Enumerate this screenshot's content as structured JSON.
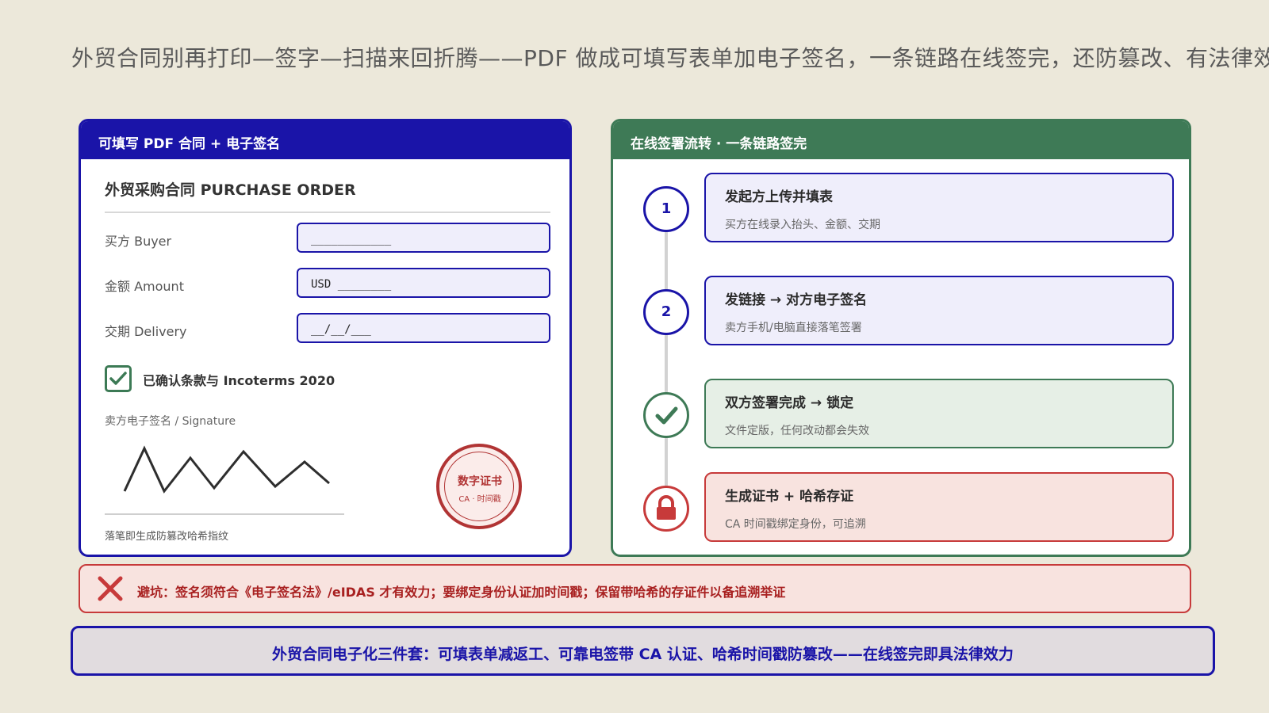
{
  "headline": "外贸合同别再打印—签字—扫描来回折腾——PDF 做成可填写表单加电子签名，一条链路在线签完，还防篡改、有法律效力",
  "left_card": {
    "header": "可填写 PDF 合同 + 电子签名",
    "doc_title": "外贸采购合同 PURCHASE ORDER",
    "fields": [
      {
        "label": "买方 Buyer",
        "value": "____________"
      },
      {
        "label": "金额 Amount",
        "value": "USD ________"
      },
      {
        "label": "交期 Delivery",
        "value": "__/__/___"
      }
    ],
    "checkbox_label": "已确认条款与 Incoterms 2020",
    "checkbox_checked": true,
    "signature_label": "卖方电子签名 / Signature",
    "signature_note": "落笔即生成防篡改哈希指纹",
    "seal": {
      "line1": "数字证书",
      "line2": "CA · 时间戳"
    }
  },
  "right_card": {
    "header": "在线签署流转 · 一条链路签完",
    "steps": [
      {
        "marker": "1",
        "title": "发起方上传并填表",
        "subtitle": "买方在线录入抬头、金额、交期",
        "style": "blue"
      },
      {
        "marker": "2",
        "title": "发链接 → 对方电子签名",
        "subtitle": "卖方手机/电脑直接落笔签署",
        "style": "blue"
      },
      {
        "marker": "check-icon",
        "title": "双方签署完成 → 锁定",
        "subtitle": "文件定版，任何改动都会失效",
        "style": "green"
      },
      {
        "marker": "lock-icon",
        "title": "生成证书 + 哈希存证",
        "subtitle": "CA 时间戳绑定身份，可追溯",
        "style": "red"
      }
    ]
  },
  "warning": "避坑：签名须符合《电子签名法》/eIDAS 才有效力；要绑定身份认证加时间戳；保留带哈希的存证件以备追溯举证",
  "summary": "外贸合同电子化三件套：可填表单减返工、可靠电签带 CA 认证、哈希时间戳防篡改——在线签完即具法律效力",
  "colors": {
    "blue": "#1a14a8",
    "green": "#3e7a56",
    "red": "#c73a3a",
    "background": "#ece8da"
  }
}
